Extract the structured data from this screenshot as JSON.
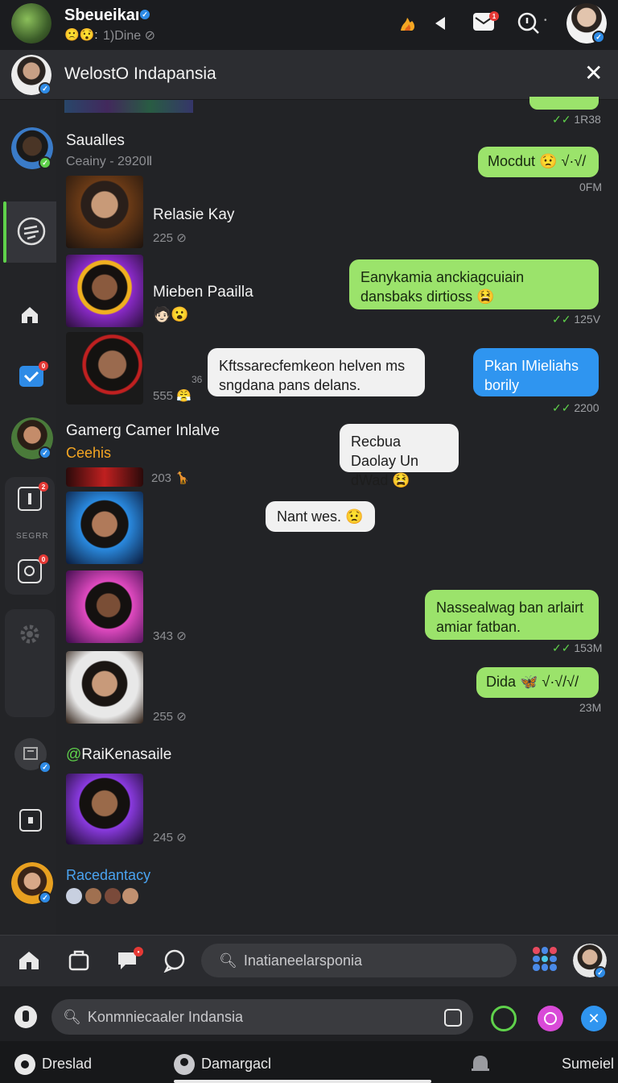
{
  "topbar": {
    "title": "Sbeueikan",
    "status": "1)Dine ⊘",
    "status_emoji": "🙁😯:"
  },
  "chat_header": {
    "title": "WelostO Indapansia",
    "close": "✕"
  },
  "conversations": [
    {
      "name": "Saualles",
      "sub": "Ceainy - 2920Ⅱ"
    },
    {
      "name": "Relasie Kay",
      "sub": "225 ⊘"
    },
    {
      "name": "Mieben Paailla",
      "sub": "🧑🏻😮"
    },
    {
      "name": "",
      "sub": "555 😤",
      "side_num": "36"
    },
    {
      "name": "Gamerg Camer Inlalve",
      "sub": "Ceehis"
    },
    {
      "name": "",
      "sub": "203 🦒"
    },
    {
      "name": "",
      "sub": "343 ⊘"
    },
    {
      "name": "",
      "sub": "255 ⊘"
    },
    {
      "name": "RaiKenasaile",
      "sub": "245 ⊘"
    },
    {
      "name": "Racedantacy",
      "sub": ""
    }
  ],
  "rail": {
    "label": "SEGRR",
    "badge_num": "0",
    "badge_num2": "2"
  },
  "messages": [
    {
      "text": "Mocdut 😟 √·√/",
      "time": "0FM"
    },
    {
      "text": "Eanykamia anckiagcuiain dansbaks dirtioss 😫",
      "time": "125V"
    },
    {
      "text": "Kftssarecfemkeon helven ms sngdana pans delans.",
      "time": ""
    },
    {
      "text": "Pkan IMieliahs borily",
      "time": "2200"
    },
    {
      "text": "Recbua Daolay Un dWad 😫",
      "time": ""
    },
    {
      "text": "Nant wes. 😟",
      "time": ""
    },
    {
      "text": "Nassealwag ban arlairt amiar fatban.",
      "time": "153M"
    },
    {
      "text": "Dida 🦋 √·√/√/",
      "time": "23M"
    },
    {
      "text": "",
      "time": "1R38"
    }
  ],
  "navbar": {
    "search_placeholder": "Inatianeelarsponia"
  },
  "searchbar": {
    "placeholder": "Konmniecaaler Indansia"
  },
  "footer": {
    "left": "Dreslad",
    "mid": "Damargacl",
    "right": "Sumeiel"
  },
  "colors": {
    "green_bubble": "#9be36b",
    "blue_bubble": "#2f95f0",
    "verified": "#2e8be6",
    "accent_orange": "#f5a623"
  }
}
